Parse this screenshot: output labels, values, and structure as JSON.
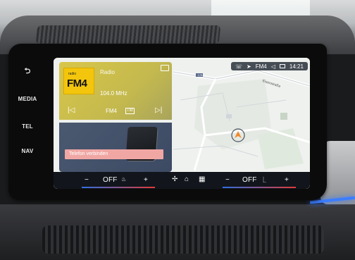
{
  "hardkeys": {
    "back_icon": "back-arrow-icon",
    "media": "MEDIA",
    "tel": "TEL",
    "nav": "NAV"
  },
  "statusbar": {
    "station": "FM4",
    "time": "14:21"
  },
  "radio": {
    "logo_small": "radio",
    "logo_big": "FM4",
    "source": "Radio",
    "frequency": "104.0 MHz",
    "station": "FM4",
    "rds": "TM"
  },
  "phone": {
    "connect_label": "Telefon verbinden"
  },
  "map": {
    "road_label": "Eisenstraße",
    "route_number": "178"
  },
  "climate": {
    "left_label": "OFF",
    "right_label": "OFF",
    "minus": "−",
    "plus": "+"
  },
  "colors": {
    "radio_card": "#d8c64a",
    "fm4_logo": "#f3c60d",
    "connect_button": "#f0a7a4",
    "climate_bar": "#12161c",
    "ambient_light": "#3c7dff"
  }
}
